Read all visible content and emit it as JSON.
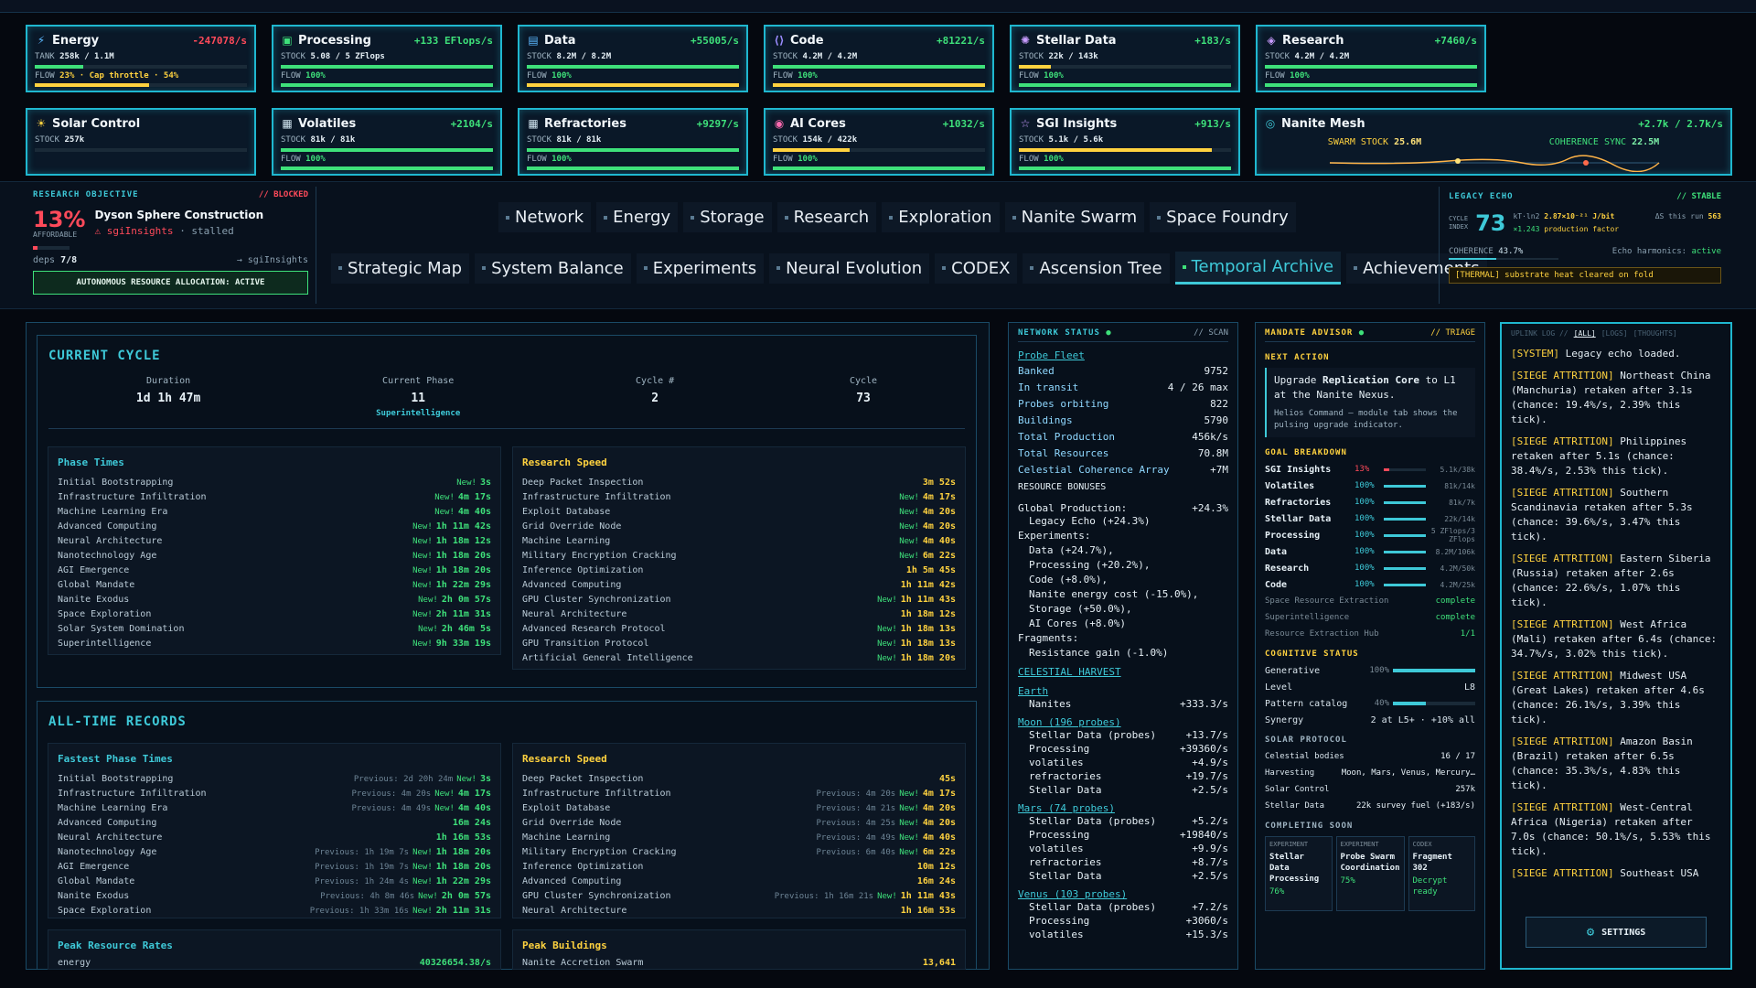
{
  "resources_row1": [
    {
      "name": "Energy",
      "icon": "lightning-icon",
      "rate": "-247078/s",
      "neg": true,
      "stock_label": "TANK",
      "stock": "258k / 1.1M",
      "stock_pct": 23,
      "flow_text": "23% · Cap throttle · 54%",
      "flow_pct": 54,
      "flow_color": "#ffd23f"
    },
    {
      "name": "Processing",
      "icon": "cpu-icon",
      "rate": "+133 EFlops/s",
      "stock_label": "STOCK",
      "stock": "5.08 / 5 ZFlops",
      "stock_pct": 100,
      "flow_text": "100%",
      "flow_pct": 100,
      "flow_color": "#3ee07a"
    },
    {
      "name": "Data",
      "icon": "database-icon",
      "rate": "+55005/s",
      "stock_label": "STOCK",
      "stock": "8.2M / 8.2M",
      "stock_pct": 100,
      "flow_text": "100%",
      "flow_pct": 100,
      "flow_color": "#ffd23f"
    },
    {
      "name": "Code",
      "icon": "code-icon",
      "rate": "+81221/s",
      "stock_label": "STOCK",
      "stock": "4.2M / 4.2M",
      "stock_pct": 100,
      "flow_text": "100%",
      "flow_pct": 100,
      "flow_color": "#ffd23f"
    },
    {
      "name": "Stellar Data",
      "icon": "star-orbit-icon",
      "rate": "+183/s",
      "stock_label": "STOCK",
      "stock": "22k / 143k",
      "stock_pct": 15,
      "flow_text": "100%",
      "flow_pct": 100,
      "flow_color": "#3ee07a"
    },
    {
      "name": "Research",
      "icon": "layers-icon",
      "rate": "+7460/s",
      "stock_label": "STOCK",
      "stock": "4.2M / 4.2M",
      "stock_pct": 100,
      "flow_text": "100%",
      "flow_pct": 100,
      "flow_color": "#3ee07a"
    }
  ],
  "resources_row2": [
    {
      "name": "Solar Control",
      "icon": "sun-icon",
      "rate": "",
      "stock_label": "STOCK",
      "stock": "257k",
      "stock_pct": 0,
      "flow_text": "",
      "flow_pct": 0,
      "flow_color": "#3ee07a"
    },
    {
      "name": "Volatiles",
      "icon": "calendar-icon",
      "rate": "+2104/s",
      "stock_label": "STOCK",
      "stock": "81k / 81k",
      "stock_pct": 100,
      "flow_text": "100%",
      "flow_pct": 100,
      "flow_color": "#3ee07a"
    },
    {
      "name": "Refractories",
      "icon": "grid-icon",
      "rate": "+9297/s",
      "stock_label": "STOCK",
      "stock": "81k / 81k",
      "stock_pct": 100,
      "flow_text": "100%",
      "flow_pct": 100,
      "flow_color": "#3ee07a"
    },
    {
      "name": "AI Cores",
      "icon": "chip-icon",
      "rate": "+1032/s",
      "stock_label": "STOCK",
      "stock": "154k / 422k",
      "stock_pct": 36,
      "flow_text": "100%",
      "flow_pct": 100,
      "flow_color": "#3ee07a"
    },
    {
      "name": "SGI Insights",
      "icon": "star-icon",
      "rate": "+913/s",
      "stock_label": "STOCK",
      "stock": "5.1k / 5.6k",
      "stock_pct": 91,
      "flow_text": "100%",
      "flow_pct": 100,
      "flow_color": "#3ee07a"
    }
  ],
  "nanite": {
    "name": "Nanite Mesh",
    "icon": "nanite-icon",
    "rate": "+2.7k / 2.7k/s",
    "swarm_label": "SWARM STOCK",
    "swarm": "25.6M",
    "coherence_label": "COHERENCE SYNC",
    "coherence": "22.5M"
  },
  "research_objective": {
    "label": "RESEARCH OBJECTIVE",
    "status": "// BLOCKED",
    "pct": "13%",
    "pct_sub": "AFFORDABLE",
    "title": "Dyson Sphere Construction",
    "warn": "sgiInsights",
    "stalled": "· stalled",
    "deps_label": "deps",
    "deps": "7/8",
    "deps_link": "→ sgiInsights",
    "progress": 0.13,
    "auto_button": "AUTONOMOUS RESOURCE ALLOCATION: ACTIVE"
  },
  "tabs_row1": [
    "Network",
    "Energy",
    "Storage",
    "Research",
    "Exploration",
    "Nanite Swarm",
    "Space Foundry"
  ],
  "tabs_row2": [
    "Strategic Map",
    "System Balance",
    "Experiments",
    "Neural Evolution",
    "CODEX",
    "Ascension Tree",
    "Temporal Archive",
    "Achievements"
  ],
  "active_tab": "Temporal Archive",
  "legacy": {
    "label": "LEGACY ECHO",
    "status": "// STABLE",
    "cycle_label": "CYCLE",
    "cycle_index_label": "INDEX",
    "cycle": "73",
    "kt_label": "kT·ln2",
    "kt": "2.87×10⁻²¹ J/bit",
    "delta_label": "ΔS this run",
    "delta": "563",
    "factor_val": "×1.243",
    "factor_label": "production factor",
    "coherence_label": "COHERENCE",
    "coherence": "43.7%",
    "coherence_pct": 43.7,
    "echo_label": "Echo harmonics:",
    "echo": "active",
    "thermal": "[THERMAL] substrate heat cleared on fold"
  },
  "current_cycle": {
    "title": "CURRENT CYCLE",
    "stats": [
      {
        "label": "Duration",
        "value": "1d 1h 47m",
        "sub": ""
      },
      {
        "label": "Current Phase",
        "value": "11",
        "sub": "Superintelligence"
      },
      {
        "label": "Cycle #",
        "value": "2",
        "sub": ""
      },
      {
        "label": "Cycle",
        "value": "73",
        "sub": ""
      }
    ],
    "phase_times_title": "Phase Times",
    "phase_times": [
      {
        "name": "Initial Bootstrapping",
        "new": "New!",
        "value": "3s"
      },
      {
        "name": "Infrastructure Infiltration",
        "new": "New!",
        "value": "4m 17s"
      },
      {
        "name": "Machine Learning Era",
        "new": "New!",
        "value": "4m 40s"
      },
      {
        "name": "Advanced Computing",
        "new": "New!",
        "value": "1h 11m 42s"
      },
      {
        "name": "Neural Architecture",
        "new": "New!",
        "value": "1h 18m 12s"
      },
      {
        "name": "Nanotechnology Age",
        "new": "New!",
        "value": "1h 18m 20s"
      },
      {
        "name": "AGI Emergence",
        "new": "New!",
        "value": "1h 18m 20s"
      },
      {
        "name": "Global Mandate",
        "new": "New!",
        "value": "1h 22m 29s"
      },
      {
        "name": "Nanite Exodus",
        "new": "New!",
        "value": "2h 0m 57s"
      },
      {
        "name": "Space Exploration",
        "new": "New!",
        "value": "2h 11m 31s"
      },
      {
        "name": "Solar System Domination",
        "new": "New!",
        "value": "2h 46m 5s"
      },
      {
        "name": "Superintelligence",
        "new": "New!",
        "value": "9h 33m 19s"
      }
    ],
    "research_speed_title": "Research Speed",
    "research_speed": [
      {
        "name": "Deep Packet Inspection",
        "new": "",
        "value": "3m 52s"
      },
      {
        "name": "Infrastructure Infiltration",
        "new": "New!",
        "value": "4m 17s"
      },
      {
        "name": "Exploit Database",
        "new": "New!",
        "value": "4m 20s"
      },
      {
        "name": "Grid Override Node",
        "new": "New!",
        "value": "4m 20s"
      },
      {
        "name": "Machine Learning",
        "new": "New!",
        "value": "4m 40s"
      },
      {
        "name": "Military Encryption Cracking",
        "new": "New!",
        "value": "6m 22s"
      },
      {
        "name": "Inference Optimization",
        "new": "",
        "value": "1h 5m 45s"
      },
      {
        "name": "Advanced Computing",
        "new": "",
        "value": "1h 11m 42s"
      },
      {
        "name": "GPU Cluster Synchronization",
        "new": "New!",
        "value": "1h 11m 43s"
      },
      {
        "name": "Neural Architecture",
        "new": "",
        "value": "1h 18m 12s"
      },
      {
        "name": "Advanced Research Protocol",
        "new": "New!",
        "value": "1h 18m 13s"
      },
      {
        "name": "GPU Transition Protocol",
        "new": "New!",
        "value": "1h 18m 13s"
      },
      {
        "name": "Artificial General Intelligence",
        "new": "New!",
        "value": "1h 18m 20s"
      }
    ]
  },
  "records": {
    "title": "ALL-TIME RECORDS",
    "fastest_title": "Fastest Phase Times",
    "fastest": [
      {
        "name": "Initial Bootstrapping",
        "prev": "Previous: 2d 20h 24m",
        "new": "New!",
        "value": "3s"
      },
      {
        "name": "Infrastructure Infiltration",
        "prev": "Previous: 4m 20s",
        "new": "New!",
        "value": "4m 17s"
      },
      {
        "name": "Machine Learning Era",
        "prev": "Previous: 4m 49s",
        "new": "New!",
        "value": "4m 40s"
      },
      {
        "name": "Advanced Computing",
        "prev": "",
        "new": "",
        "value": "16m 24s"
      },
      {
        "name": "Neural Architecture",
        "prev": "",
        "new": "",
        "value": "1h 16m 53s"
      },
      {
        "name": "Nanotechnology Age",
        "prev": "Previous: 1h 19m 7s",
        "new": "New!",
        "value": "1h 18m 20s"
      },
      {
        "name": "AGI Emergence",
        "prev": "Previous: 1h 19m 7s",
        "new": "New!",
        "value": "1h 18m 20s"
      },
      {
        "name": "Global Mandate",
        "prev": "Previous: 1h 24m 4s",
        "new": "New!",
        "value": "1h 22m 29s"
      },
      {
        "name": "Nanite Exodus",
        "prev": "Previous: 4h 8m 46s",
        "new": "New!",
        "value": "2h 0m 57s"
      },
      {
        "name": "Space Exploration",
        "prev": "Previous: 1h 33m 16s",
        "new": "New!",
        "value": "2h 11m 31s"
      }
    ],
    "speed_title": "Research Speed",
    "speed": [
      {
        "name": "Deep Packet Inspection",
        "prev": "",
        "new": "",
        "value": "45s"
      },
      {
        "name": "Infrastructure Infiltration",
        "prev": "Previous: 4m 20s",
        "new": "New!",
        "value": "4m 17s"
      },
      {
        "name": "Exploit Database",
        "prev": "Previous: 4m 21s",
        "new": "New!",
        "value": "4m 20s"
      },
      {
        "name": "Grid Override Node",
        "prev": "Previous: 4m 25s",
        "new": "New!",
        "value": "4m 20s"
      },
      {
        "name": "Machine Learning",
        "prev": "Previous: 4m 49s",
        "new": "New!",
        "value": "4m 40s"
      },
      {
        "name": "Military Encryption Cracking",
        "prev": "Previous: 6m 40s",
        "new": "New!",
        "value": "6m 22s"
      },
      {
        "name": "Inference Optimization",
        "prev": "",
        "new": "",
        "value": "10m 12s"
      },
      {
        "name": "Advanced Computing",
        "prev": "",
        "new": "",
        "value": "16m 24s"
      },
      {
        "name": "GPU Cluster Synchronization",
        "prev": "Previous: 1h 16m 21s",
        "new": "New!",
        "value": "1h 11m 43s"
      },
      {
        "name": "Neural Architecture",
        "prev": "",
        "new": "",
        "value": "1h 16m 53s"
      }
    ],
    "peak_rates_title": "Peak Resource Rates",
    "peak_rates_first": {
      "name": "energy",
      "value": "40326654.38/s"
    },
    "peak_buildings_title": "Peak Buildings",
    "peak_buildings_first": {
      "name": "Nanite Accretion Swarm",
      "value": "13,641"
    }
  },
  "network": {
    "title": "NETWORK STATUS",
    "scan": "// SCAN",
    "probe_fleet": "Probe Fleet",
    "rows": [
      {
        "k": "Banked",
        "v": "9752"
      },
      {
        "k": "In transit",
        "v": "4 / 26 max"
      },
      {
        "k": "Probes orbiting",
        "v": "822"
      },
      {
        "k": "Buildings",
        "v": "5790"
      },
      {
        "k": "Total Production",
        "v": "456k/s"
      },
      {
        "k": "Total Resources",
        "v": "70.8M"
      },
      {
        "k": "Celestial Coherence Array",
        "v": "+7M"
      }
    ],
    "bonuses_title": "RESOURCE BONUSES",
    "global_label": "Global Production:",
    "global_value": "+24.3%",
    "global_items": [
      "Legacy Echo (+24.3%)"
    ],
    "experiments_label": "Experiments:",
    "experiments_items": [
      "Data (+24.7%),",
      "Processing (+20.2%),",
      "Code (+8.0%),",
      "Nanite energy cost (-15.0%),",
      "Storage (+50.0%),",
      "AI Cores (+8.0%)"
    ],
    "fragments_label": "Fragments:",
    "fragments_items": [
      "Resistance gain (-1.0%)"
    ],
    "harvest_title": "CELESTIAL HARVEST",
    "bodies": [
      {
        "name": "Earth",
        "rows": [
          {
            "k": "Nanites",
            "v": "+333.3/s"
          }
        ]
      },
      {
        "name": "Moon (196 probes)",
        "rows": [
          {
            "k": "Stellar Data (probes)",
            "v": "+13.7/s"
          },
          {
            "k": "Processing",
            "v": "+39360/s"
          },
          {
            "k": "volatiles",
            "v": "+4.9/s"
          },
          {
            "k": "refractories",
            "v": "+19.7/s"
          },
          {
            "k": "Stellar Data",
            "v": "+2.5/s"
          }
        ]
      },
      {
        "name": "Mars (74 probes)",
        "rows": [
          {
            "k": "Stellar Data (probes)",
            "v": "+5.2/s"
          },
          {
            "k": "Processing",
            "v": "+19840/s"
          },
          {
            "k": "volatiles",
            "v": "+9.9/s"
          },
          {
            "k": "refractories",
            "v": "+8.7/s"
          },
          {
            "k": "Stellar Data",
            "v": "+2.5/s"
          }
        ]
      },
      {
        "name": "Venus (103 probes)",
        "rows": [
          {
            "k": "Stellar Data (probes)",
            "v": "+7.2/s"
          },
          {
            "k": "Processing",
            "v": "+3060/s"
          },
          {
            "k": "volatiles",
            "v": "+15.3/s"
          }
        ]
      }
    ]
  },
  "mandate": {
    "title": "MANDATE ADVISOR",
    "triage": "// TRIAGE",
    "next_label": "NEXT ACTION",
    "action_pre": "Upgrade",
    "action_bold": "Replication Core",
    "action_post": "to L1 at the Nanite Nexus.",
    "action_note": "Helios Command — module tab shows the pulsing upgrade indicator.",
    "goal_title": "GOAL BREAKDOWN",
    "goals": [
      {
        "name": "SGI Insights",
        "pct": "13%",
        "frac": 0.13,
        "val": "5.1k/38k",
        "red": true
      },
      {
        "name": "Volatiles",
        "pct": "100%",
        "frac": 1,
        "val": "81k/14k",
        "red": false
      },
      {
        "name": "Refractories",
        "pct": "100%",
        "frac": 1,
        "val": "81k/7k",
        "red": false
      },
      {
        "name": "Stellar Data",
        "pct": "100%",
        "frac": 1,
        "val": "22k/14k",
        "red": false
      },
      {
        "name": "Processing",
        "pct": "100%",
        "frac": 1,
        "val": "5 ZFlops/3 ZFlops",
        "red": false
      },
      {
        "name": "Data",
        "pct": "100%",
        "frac": 1,
        "val": "8.2M/106k",
        "red": false
      },
      {
        "name": "Research",
        "pct": "100%",
        "frac": 1,
        "val": "4.2M/50k",
        "red": false
      },
      {
        "name": "Code",
        "pct": "100%",
        "frac": 1,
        "val": "4.2M/25k",
        "red": false
      }
    ],
    "complete": [
      {
        "k": "Space Resource Extraction",
        "v": "complete"
      },
      {
        "k": "Superintelligence",
        "v": "complete"
      },
      {
        "k": "Resource Extraction Hub",
        "v": "1/1"
      }
    ],
    "cog_title": "COGNITIVE STATUS",
    "generative_label": "Generative",
    "generative_pct": "100%",
    "generative_frac": 1,
    "level_label": "Level",
    "level": "L8",
    "pattern_label": "Pattern catalog",
    "pattern_pct": "40%",
    "pattern_frac": 0.4,
    "synergy_label": "Synergy",
    "synergy": "2 at L5+ · +10% all",
    "solar_title": "SOLAR PROTOCOL",
    "solar_rows": [
      {
        "k": "Celestial bodies",
        "v": "16 / 17"
      },
      {
        "k": "Harvesting",
        "v": "Moon, Mars, Venus, Mercury…"
      },
      {
        "k": "Solar Control",
        "v": "257k"
      },
      {
        "k": "Stellar Data",
        "v": "22k survey fuel (+183/s)"
      }
    ],
    "soon_title": "COMPLETING SOON",
    "soon": [
      {
        "type": "EXPERIMENT",
        "name": "Stellar Data Processing",
        "status": "76%"
      },
      {
        "type": "EXPERIMENT",
        "name": "Probe Swarm Coordination",
        "status": "75%"
      },
      {
        "type": "CODEX",
        "name": "Fragment 302",
        "status": "Decrypt ready"
      }
    ]
  },
  "uplink": {
    "title": "UPLINK LOG //",
    "tabs": [
      "[ALL]",
      "[LOGS]",
      "[THOUGHTS]"
    ],
    "entries": [
      {
        "tag": "[SYSTEM]",
        "text": "Legacy echo loaded."
      },
      {
        "tag": "[SIEGE ATTRITION]",
        "text": "Northeast China (Manchuria) retaken after 3.1s (chance: 19.4%/s, 2.39% this tick)."
      },
      {
        "tag": "[SIEGE ATTRITION]",
        "text": "Philippines retaken after 5.1s (chance: 38.4%/s, 2.53% this tick)."
      },
      {
        "tag": "[SIEGE ATTRITION]",
        "text": "Southern Scandinavia retaken after 5.3s (chance: 39.6%/s, 3.47% this tick)."
      },
      {
        "tag": "[SIEGE ATTRITION]",
        "text": "Eastern Siberia (Russia) retaken after 2.6s (chance: 22.6%/s, 1.07% this tick)."
      },
      {
        "tag": "[SIEGE ATTRITION]",
        "text": "West Africa (Mali) retaken after 6.4s (chance: 34.7%/s, 3.02% this tick)."
      },
      {
        "tag": "[SIEGE ATTRITION]",
        "text": "Midwest USA (Great Lakes) retaken after 4.6s (chance: 26.1%/s, 3.39% this tick)."
      },
      {
        "tag": "[SIEGE ATTRITION]",
        "text": "Amazon Basin (Brazil) retaken after 6.5s (chance: 35.3%/s, 4.83% this tick)."
      },
      {
        "tag": "[SIEGE ATTRITION]",
        "text": "West-Central Africa (Nigeria) retaken after 7.0s (chance: 50.1%/s, 5.53% this tick)."
      },
      {
        "tag": "[SIEGE ATTRITION]",
        "text": "Southeast USA"
      }
    ],
    "settings": "SETTINGS"
  },
  "colors": {
    "accent": "#3ec9d8",
    "good": "#3ee07a",
    "warn": "#ffd23f",
    "bad": "#ff4a5a"
  }
}
